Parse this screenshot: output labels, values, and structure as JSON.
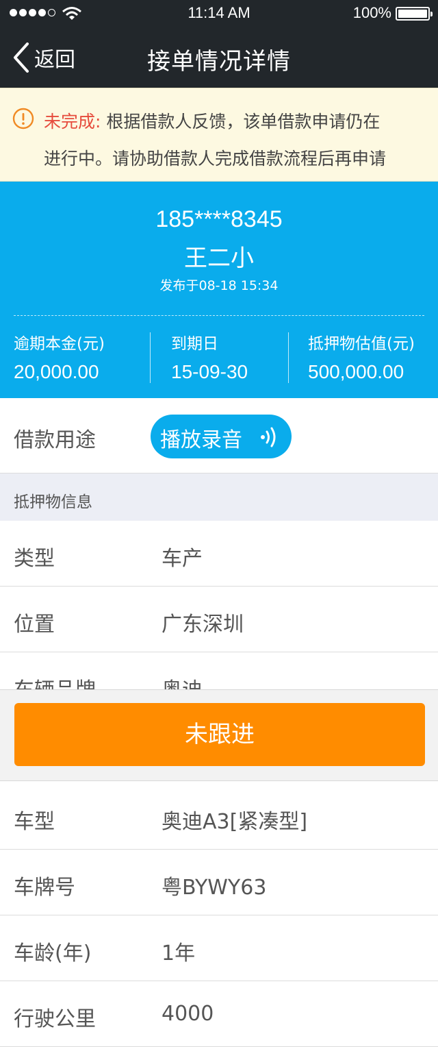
{
  "status_bar": {
    "time": "11:14 AM",
    "battery": "100%"
  },
  "nav": {
    "back_label": "返回",
    "title": "接单情况详情"
  },
  "notice": {
    "label": "未完成:",
    "line1": "根据借款人反馈，该单借款申请仍在",
    "line2": "进行中。请协助借款人完成借款流程后再申请",
    "label_color": "#e64b3c"
  },
  "summary": {
    "phone": "185****8345",
    "name": "王二小",
    "published": "发布于08-18  15:34",
    "stats": [
      {
        "label": "逾期本金(元)",
        "value": "20,000.00"
      },
      {
        "label": "到期日",
        "value": "15-09-30"
      },
      {
        "label": "抵押物估值(元)",
        "value": "500,000.00"
      }
    ],
    "background_color": "#0aacec"
  },
  "purpose": {
    "label": "借款用途",
    "play_label": "播放录音"
  },
  "collateral": {
    "section_title": "抵押物信息",
    "rows": [
      {
        "key": "类型",
        "value": "车产"
      },
      {
        "key": "位置",
        "value": "广东深圳"
      },
      {
        "key": "车辆品牌",
        "value": "奥迪"
      },
      {
        "key": "车型",
        "value": "奥迪A3[紧凑型]"
      },
      {
        "key": "车牌号",
        "value": "粤BYWY63"
      },
      {
        "key": "车龄(年)",
        "value": "1年"
      },
      {
        "key": "行驶公里",
        "value": "4000"
      }
    ]
  },
  "action": {
    "button_label": "未跟进",
    "button_color": "#ff8c00"
  }
}
